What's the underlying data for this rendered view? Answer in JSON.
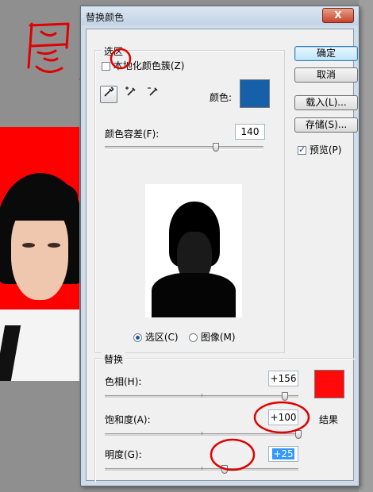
{
  "dialog": {
    "title": "替换颜色",
    "close_label": "X"
  },
  "selection": {
    "group_label": "选区",
    "localized_checkbox_label": "本地化颜色簇(Z)",
    "localized_checked": false,
    "color_label": "颜色:",
    "selected_color": "#1560a8",
    "fuzziness_label": "颜色容差(F):",
    "fuzziness_value": "140",
    "fuzziness_fraction": 0.7,
    "radio_selection": "选区(C)",
    "radio_image": "图像(M)",
    "active_view": "selection"
  },
  "tools": [
    {
      "name": "eyedropper-icon",
      "active": true
    },
    {
      "name": "eyedropper-plus-icon",
      "active": false
    },
    {
      "name": "eyedropper-minus-icon",
      "active": false
    }
  ],
  "replacement": {
    "group_label": "替换",
    "hue_label": "色相(H):",
    "hue_value": "+156",
    "hue_fraction": 0.93,
    "saturation_label": "饱和度(A):",
    "saturation_value": "+100",
    "saturation_fraction": 1.0,
    "lightness_label": "明度(G):",
    "lightness_value": "+25",
    "lightness_fraction": 0.62,
    "result_label": "结果",
    "result_color": "#ff0a0a"
  },
  "buttons": {
    "ok": "确定",
    "cancel": "取消",
    "load": "载入(L)...",
    "save": "存储(S)...",
    "preview_label": "预览(P)",
    "preview_checked": true
  },
  "annotation": {
    "handwriting": "图/",
    "ink_color": "#e00000"
  }
}
